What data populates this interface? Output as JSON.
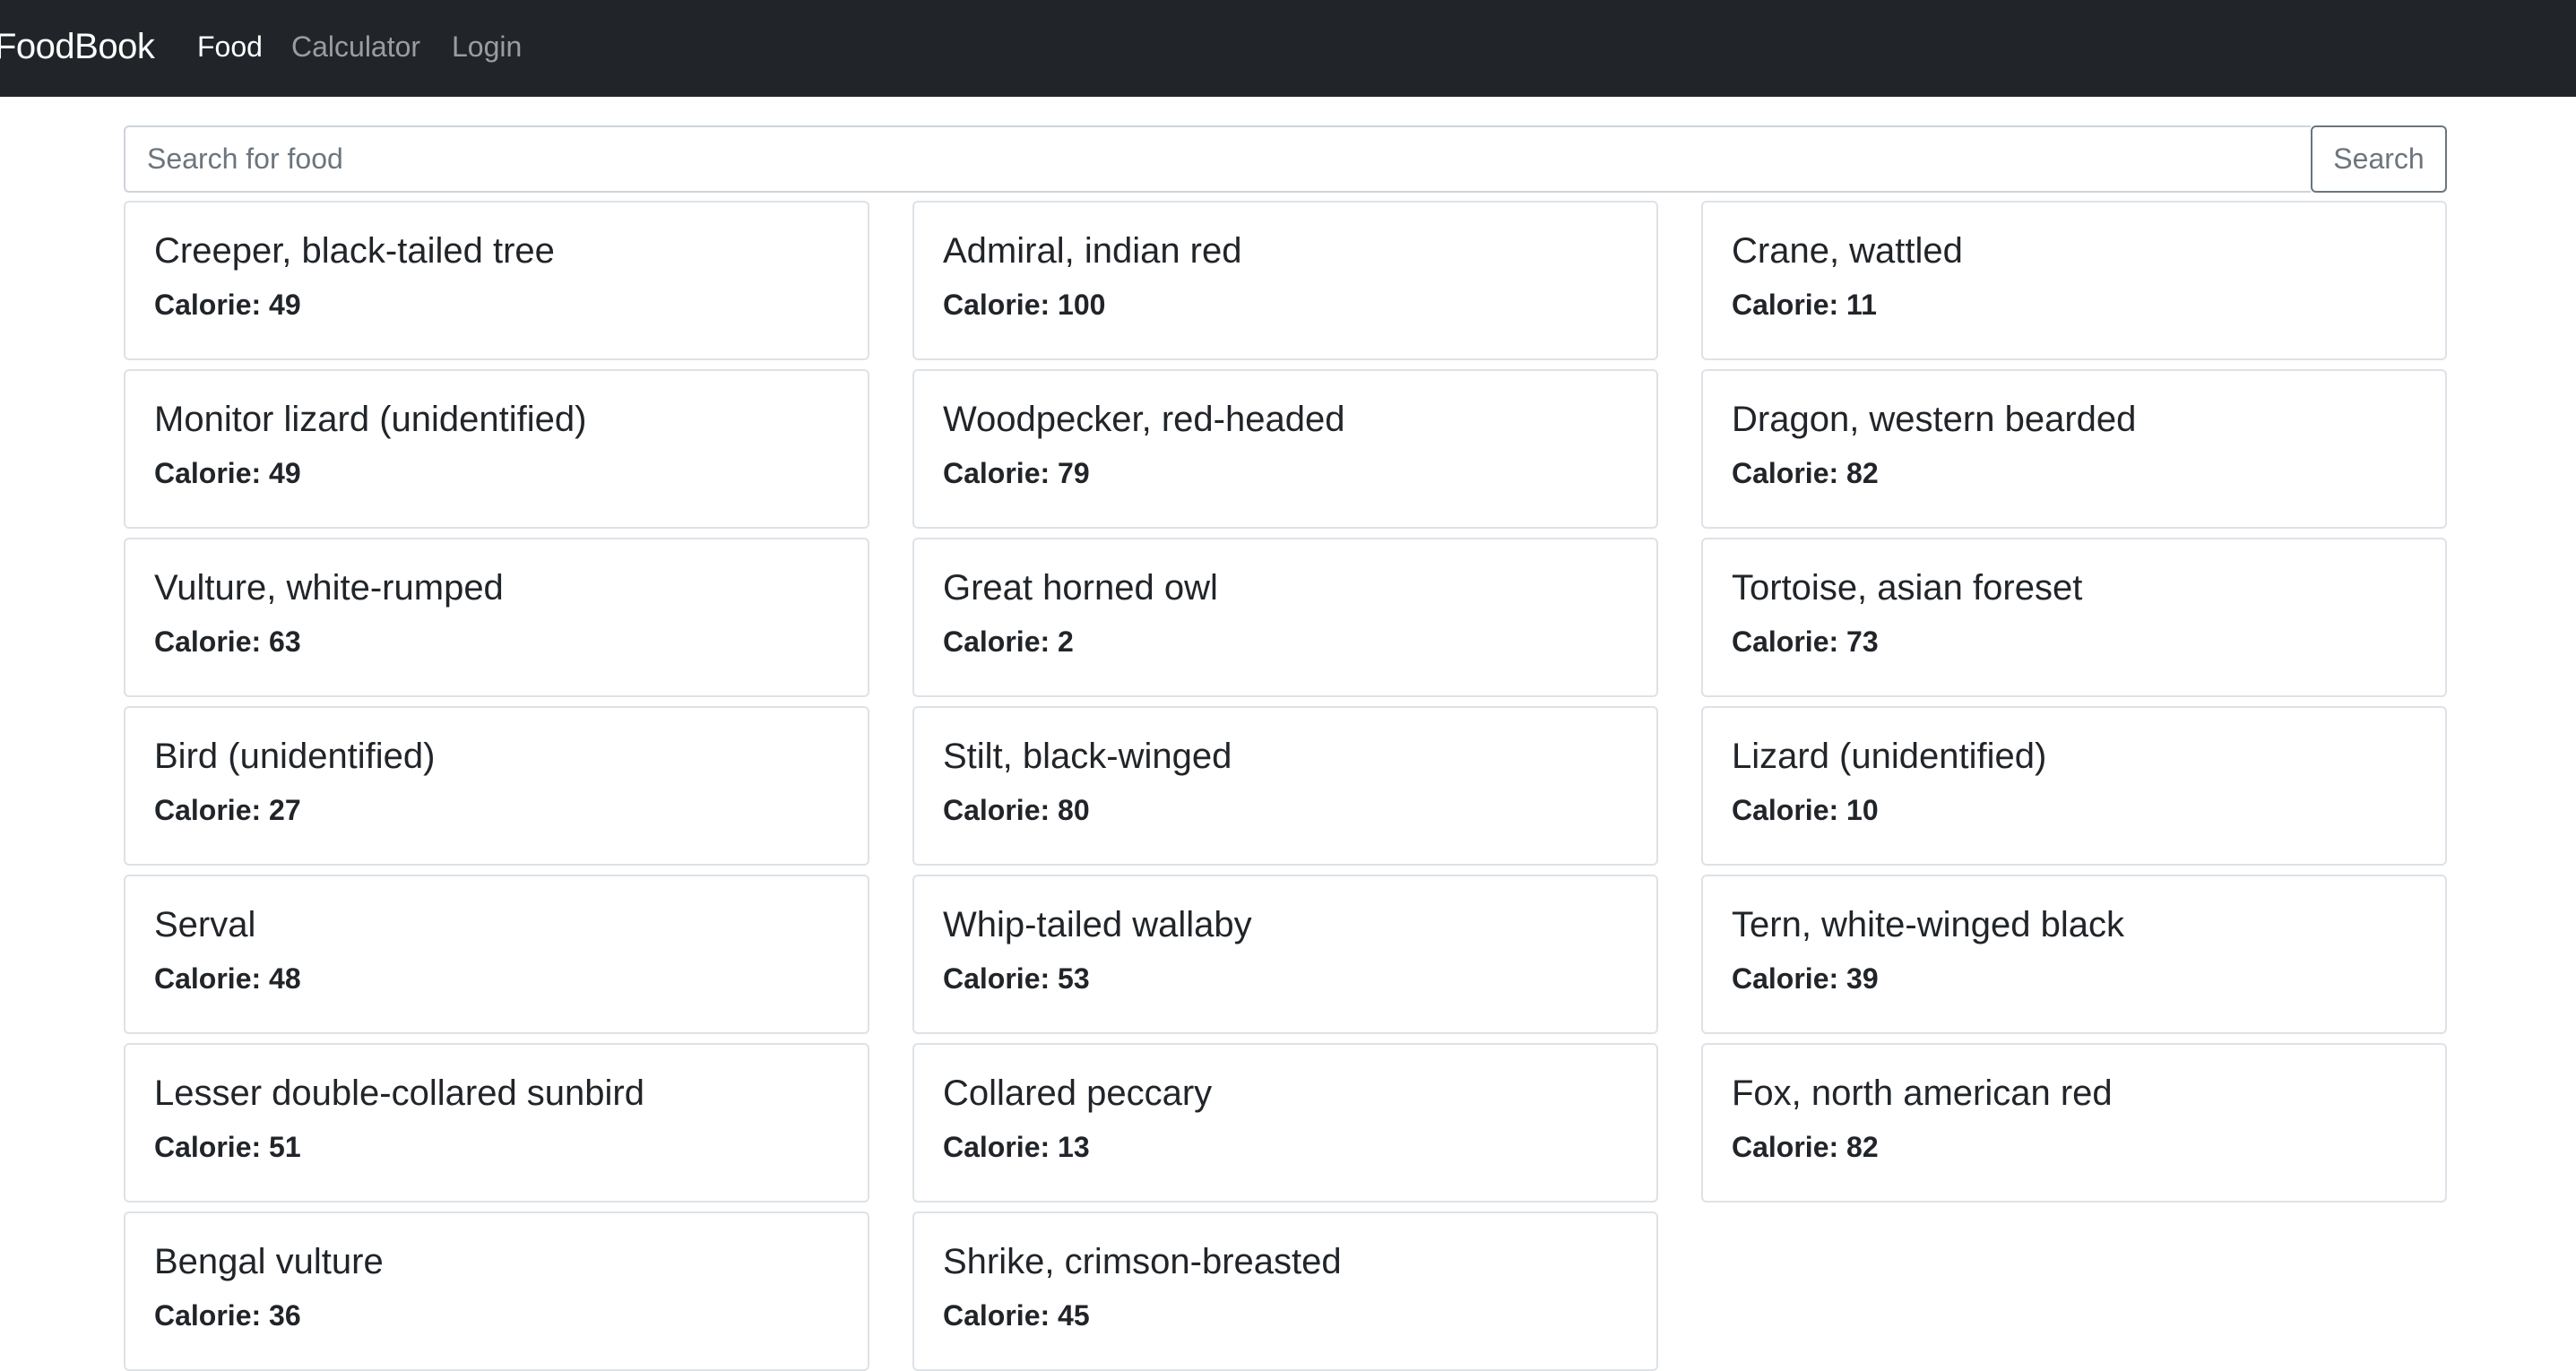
{
  "navbar": {
    "brand": "FoodBook",
    "links": [
      {
        "label": "Food",
        "active": true
      },
      {
        "label": "Calculator",
        "active": false
      },
      {
        "label": "Login",
        "active": false
      }
    ]
  },
  "search": {
    "placeholder": "Search for food",
    "value": "",
    "button_label": "Search"
  },
  "foods": [
    {
      "name": "Creeper, black-tailed tree",
      "calorie": "Calorie: 49"
    },
    {
      "name": "Admiral, indian red",
      "calorie": "Calorie: 100"
    },
    {
      "name": "Crane, wattled",
      "calorie": "Calorie: 11"
    },
    {
      "name": "Monitor lizard (unidentified)",
      "calorie": "Calorie: 49"
    },
    {
      "name": "Woodpecker, red-headed",
      "calorie": "Calorie: 79"
    },
    {
      "name": "Dragon, western bearded",
      "calorie": "Calorie: 82"
    },
    {
      "name": "Vulture, white-rumped",
      "calorie": "Calorie: 63"
    },
    {
      "name": "Great horned owl",
      "calorie": "Calorie: 2"
    },
    {
      "name": "Tortoise, asian foreset",
      "calorie": "Calorie: 73"
    },
    {
      "name": "Bird (unidentified)",
      "calorie": "Calorie: 27"
    },
    {
      "name": "Stilt, black-winged",
      "calorie": "Calorie: 80"
    },
    {
      "name": "Lizard (unidentified)",
      "calorie": "Calorie: 10"
    },
    {
      "name": "Serval",
      "calorie": "Calorie: 48"
    },
    {
      "name": "Whip-tailed wallaby",
      "calorie": "Calorie: 53"
    },
    {
      "name": "Tern, white-winged black",
      "calorie": "Calorie: 39"
    },
    {
      "name": "Lesser double-collared sunbird",
      "calorie": "Calorie: 51"
    },
    {
      "name": "Collared peccary",
      "calorie": "Calorie: 13"
    },
    {
      "name": "Fox, north american red",
      "calorie": "Calorie: 82"
    },
    {
      "name": "Bengal vulture",
      "calorie": "Calorie: 36"
    },
    {
      "name": "Shrike, crimson-breasted",
      "calorie": "Calorie: 45"
    }
  ]
}
